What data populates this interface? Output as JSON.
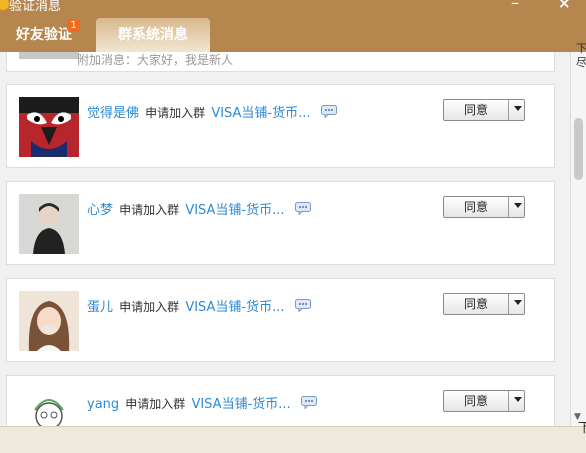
{
  "window": {
    "title": "验证消息",
    "minimize": "–",
    "close": "×"
  },
  "tabs": [
    {
      "label": "好友验证",
      "badge": "1"
    },
    {
      "label": "群系统消息"
    }
  ],
  "first_row": {
    "text": "附加消息：大家好，我是新人"
  },
  "requests": [
    {
      "user": "觉得是佛",
      "action": "申请加入群",
      "group": "VISA当铺-货币...",
      "button": "同意"
    },
    {
      "user": "心梦",
      "action": "申请加入群",
      "group": "VISA当铺-货币...",
      "button": "同意"
    },
    {
      "user": "蛋儿",
      "action": "申请加入群",
      "group": "VISA当铺-货币...",
      "button": "同意"
    },
    {
      "user": "yang",
      "action": "申请加入群",
      "group": "VISA当铺-货币...",
      "button": "同意"
    }
  ],
  "right_edge_text": "下\n尽",
  "status_right": "下"
}
